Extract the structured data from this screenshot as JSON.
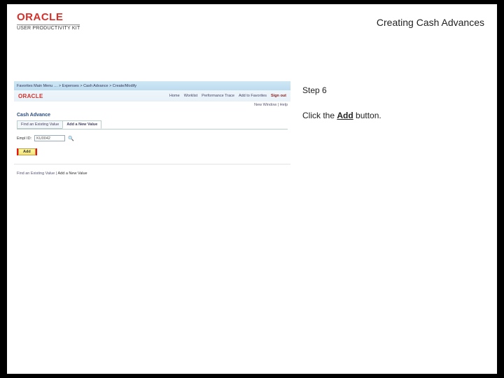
{
  "header": {
    "brand": "ORACLE",
    "brand_sub": "USER PRODUCTIVITY KIT",
    "title": "Creating Cash Advances"
  },
  "instruction": {
    "step_label": "Step 6",
    "line_pre": "Click the ",
    "line_bold": "Add",
    "line_post": " button."
  },
  "shot": {
    "topbar": {
      "crumbs": "Favorites    Main Menu    …    >    Expenses    >    Cash Advance    >    Create/Modify"
    },
    "subbar": {
      "brand": "ORACLE",
      "nav": [
        "Home",
        "Worklist",
        "Performance Trace",
        "Add to Favorites",
        "Sign out"
      ]
    },
    "newwin": "New Window | Help",
    "section_title": "Cash Advance",
    "tabs": [
      "Find an Existing Value",
      "Add a New Value"
    ],
    "active_tab_index": 1,
    "field_label": "Empl ID:",
    "field_value": "KU0042",
    "add_button": "Add",
    "finder_label": "Find an Existing Value",
    "finder_sep": " | ",
    "finder_value": "Add a New Value"
  }
}
